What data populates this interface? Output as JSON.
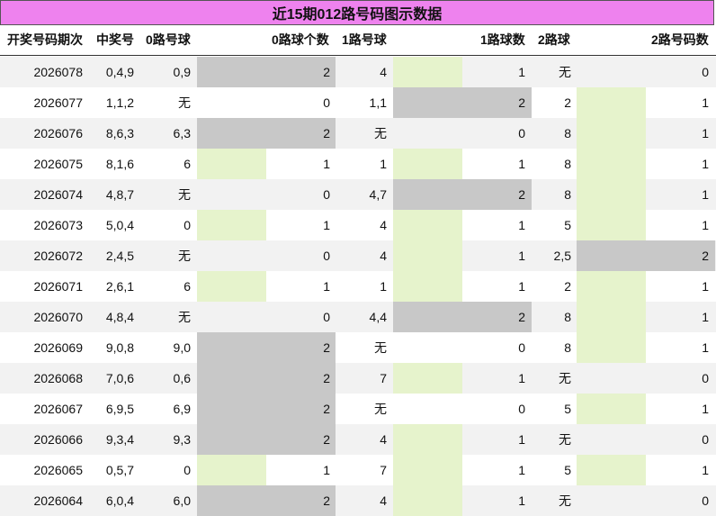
{
  "title": "近15期012路号码图示数据",
  "chart_data": {
    "type": "table",
    "columns": [
      "开奖号码期次",
      "中奖号",
      "0路号球",
      "0路球个数",
      "1路号球",
      "1路球数",
      "2路球",
      "2路号码数"
    ],
    "rows": [
      {
        "issue": "2026078",
        "number": "0,4,9",
        "r0": "0,9",
        "c0": 2,
        "r1": "4",
        "c1": 1,
        "r2": "无",
        "c2": 0
      },
      {
        "issue": "2026077",
        "number": "1,1,2",
        "r0": "无",
        "c0": 0,
        "r1": "1,1",
        "c1": 2,
        "r2": "2",
        "c2": 1
      },
      {
        "issue": "2026076",
        "number": "8,6,3",
        "r0": "6,3",
        "c0": 2,
        "r1": "无",
        "c1": 0,
        "r2": "8",
        "c2": 1
      },
      {
        "issue": "2026075",
        "number": "8,1,6",
        "r0": "6",
        "c0": 1,
        "r1": "1",
        "c1": 1,
        "r2": "8",
        "c2": 1
      },
      {
        "issue": "2026074",
        "number": "4,8,7",
        "r0": "无",
        "c0": 0,
        "r1": "4,7",
        "c1": 2,
        "r2": "8",
        "c2": 1
      },
      {
        "issue": "2026073",
        "number": "5,0,4",
        "r0": "0",
        "c0": 1,
        "r1": "4",
        "c1": 1,
        "r2": "5",
        "c2": 1
      },
      {
        "issue": "2026072",
        "number": "2,4,5",
        "r0": "无",
        "c0": 0,
        "r1": "4",
        "c1": 1,
        "r2": "2,5",
        "c2": 2
      },
      {
        "issue": "2026071",
        "number": "2,6,1",
        "r0": "6",
        "c0": 1,
        "r1": "1",
        "c1": 1,
        "r2": "2",
        "c2": 1
      },
      {
        "issue": "2026070",
        "number": "4,8,4",
        "r0": "无",
        "c0": 0,
        "r1": "4,4",
        "c1": 2,
        "r2": "8",
        "c2": 1
      },
      {
        "issue": "2026069",
        "number": "9,0,8",
        "r0": "9,0",
        "c0": 2,
        "r1": "无",
        "c1": 0,
        "r2": "8",
        "c2": 1
      },
      {
        "issue": "2026068",
        "number": "7,0,6",
        "r0": "0,6",
        "c0": 2,
        "r1": "7",
        "c1": 1,
        "r2": "无",
        "c2": 0
      },
      {
        "issue": "2026067",
        "number": "6,9,5",
        "r0": "6,9",
        "c0": 2,
        "r1": "无",
        "c1": 0,
        "r2": "5",
        "c2": 1
      },
      {
        "issue": "2026066",
        "number": "9,3,4",
        "r0": "9,3",
        "c0": 2,
        "r1": "4",
        "c1": 1,
        "r2": "无",
        "c2": 0
      },
      {
        "issue": "2026065",
        "number": "0,5,7",
        "r0": "0",
        "c0": 1,
        "r1": "7",
        "c1": 1,
        "r2": "5",
        "c2": 1
      },
      {
        "issue": "2026064",
        "number": "6,0,4",
        "r0": "6,0",
        "c0": 2,
        "r1": "4",
        "c1": 1,
        "r2": "无",
        "c2": 0
      }
    ],
    "colors": {
      "title_bg": "#ee82ee",
      "count_2": "#c8c8c8",
      "count_1": "#e6f3cc",
      "alt_row": "#f2f2f2"
    }
  }
}
